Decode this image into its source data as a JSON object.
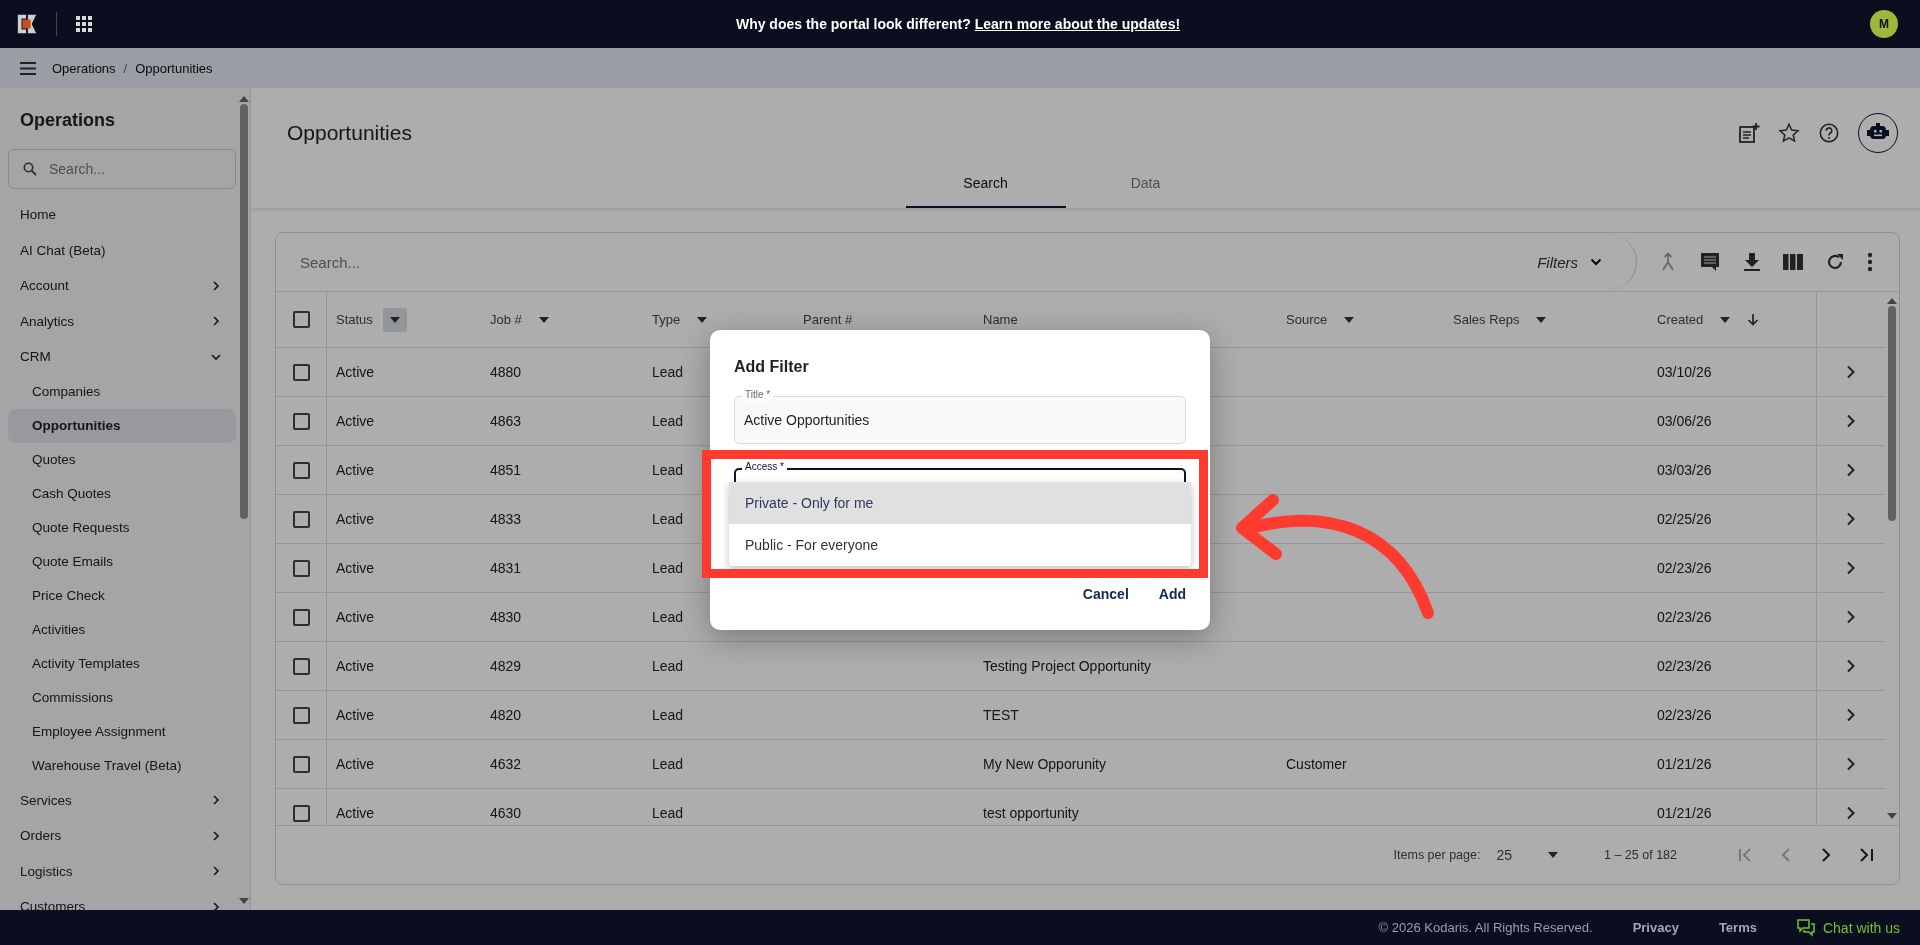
{
  "top_bar": {
    "announcement": "Why does the portal look different?",
    "announcement_link": "Learn more about the updates!",
    "avatar": "M"
  },
  "breadcrumb": {
    "items": [
      "Operations",
      "Opportunities"
    ],
    "separator": "/"
  },
  "sidebar": {
    "title": "Operations",
    "search": {
      "placeholder": "Search..."
    },
    "items": [
      {
        "label": "Home",
        "selected": false
      },
      {
        "label": "AI Chat (Beta)",
        "selected": false
      },
      {
        "label": "Account",
        "selected": false,
        "expanded": false
      },
      {
        "label": "Analytics",
        "selected": false,
        "expanded": false
      },
      {
        "label": "CRM",
        "selected": false,
        "expanded": true,
        "children": [
          {
            "label": "Companies",
            "selected": false
          },
          {
            "label": "Opportunities",
            "selected": true
          },
          {
            "label": "Quotes",
            "selected": false
          },
          {
            "label": "Cash Quotes",
            "selected": false
          },
          {
            "label": "Quote Requests",
            "selected": false
          },
          {
            "label": "Quote Emails",
            "selected": false
          },
          {
            "label": "Price Check",
            "selected": false
          },
          {
            "label": "Activities",
            "selected": false
          },
          {
            "label": "Activity Templates",
            "selected": false
          },
          {
            "label": "Commissions",
            "selected": false
          },
          {
            "label": "Employee Assignment",
            "selected": false
          },
          {
            "label": "Warehouse Travel (Beta)",
            "selected": false
          }
        ]
      },
      {
        "label": "Services",
        "selected": false,
        "expanded": false
      },
      {
        "label": "Orders",
        "selected": false,
        "expanded": false
      },
      {
        "label": "Logistics",
        "selected": false,
        "expanded": false
      },
      {
        "label": "Customers",
        "selected": false,
        "expanded": false
      }
    ]
  },
  "page": {
    "title": "Opportunities",
    "tabs": [
      {
        "label": "Search",
        "selected": true
      },
      {
        "label": "Data",
        "selected": false
      }
    ]
  },
  "table": {
    "search": {
      "placeholder": "Search..."
    },
    "filters_label": "Filters",
    "select_all": {
      "checked": false
    },
    "columns": [
      {
        "label": "Status",
        "filter_active": true
      },
      {
        "label": "Job #",
        "filter_active": false
      },
      {
        "label": "Type",
        "filter_active": false
      },
      {
        "label": "Parent #"
      },
      {
        "label": "Name"
      },
      {
        "label": "Source",
        "filter_active": false
      },
      {
        "label": "Sales Reps",
        "filter_active": false
      },
      {
        "label": "Created",
        "filter_active": false,
        "sorted_descending": true
      }
    ],
    "rows": [
      {
        "checked": false,
        "status": "Active",
        "job": "4880",
        "type": "Lead",
        "created": "03/10/26"
      },
      {
        "checked": false,
        "status": "Active",
        "job": "4863",
        "type": "Lead",
        "created": "03/06/26"
      },
      {
        "checked": false,
        "status": "Active",
        "job": "4851",
        "type": "Lead",
        "created": "03/03/26"
      },
      {
        "checked": false,
        "status": "Active",
        "job": "4833",
        "type": "Lead",
        "created": "02/25/26"
      },
      {
        "checked": false,
        "status": "Active",
        "job": "4831",
        "type": "Lead",
        "created": "02/23/26"
      },
      {
        "checked": false,
        "status": "Active",
        "job": "4830",
        "type": "Lead",
        "created": "02/23/26"
      },
      {
        "checked": false,
        "status": "Active",
        "job": "4829",
        "type": "Lead",
        "name": "Testing Project Opportunity",
        "created": "02/23/26"
      },
      {
        "checked": false,
        "status": "Active",
        "job": "4820",
        "type": "Lead",
        "name": "TEST",
        "created": "02/23/26"
      },
      {
        "checked": false,
        "status": "Active",
        "job": "4632",
        "type": "Lead",
        "name": "My New Opporunity",
        "source": "Customer",
        "created": "01/21/26"
      },
      {
        "checked": false,
        "status": "Active",
        "job": "4630",
        "type": "Lead",
        "name": "test opportunity",
        "created": "01/21/26"
      }
    ],
    "paginator": {
      "label": "Items per page:",
      "page_size": "25",
      "range": "1 – 25 of 182",
      "first_disabled": true,
      "prev_disabled": true,
      "next_disabled": false,
      "last_disabled": false
    }
  },
  "dialog": {
    "title": "Add Filter",
    "title_field": {
      "label": "Title *",
      "value": "Active Opportunities"
    },
    "access_field": {
      "label": "Access *"
    },
    "access_options": [
      {
        "label": "Private - Only for me",
        "selected": true
      },
      {
        "label": "Public - For everyone",
        "selected": false
      }
    ],
    "buttons": [
      "Cancel",
      "Add"
    ]
  },
  "footer": {
    "copyright": "© 2026 Kodaris. All Rights Reserved.",
    "links": [
      "Privacy",
      "Terms"
    ],
    "chat": "Chat with us"
  }
}
